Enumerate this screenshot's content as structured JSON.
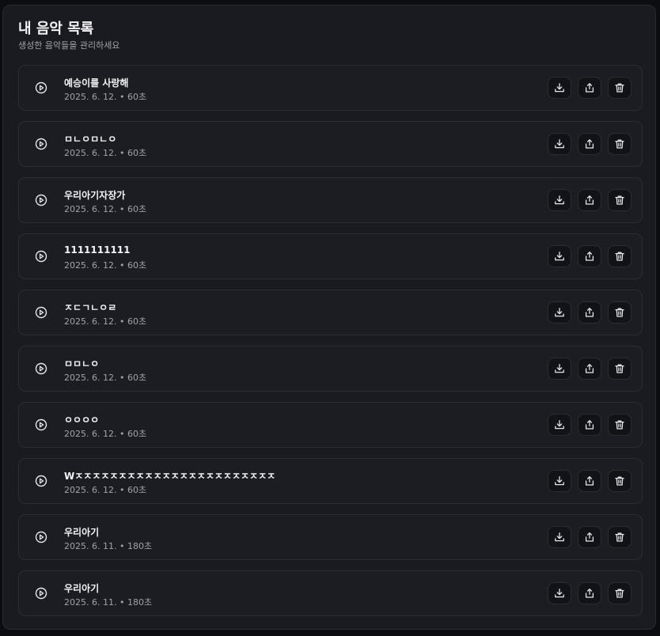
{
  "header": {
    "title": "내 음악 목록",
    "subtitle": "생성한 음악들을 관리하세요"
  },
  "icons": {
    "play": "play-circle-icon",
    "download": "download-icon",
    "share": "share-icon",
    "delete": "trash-icon"
  },
  "tracks": [
    {
      "title": "예승이를 사랑해",
      "meta": "2025. 6. 12. • 60초"
    },
    {
      "title": "ㅁㄴㅇㅁㄴㅇ",
      "meta": "2025. 6. 12. • 60초"
    },
    {
      "title": "우리아기자장가",
      "meta": "2025. 6. 12. • 60초"
    },
    {
      "title": "1111111111",
      "meta": "2025. 6. 12. • 60초"
    },
    {
      "title": "ㅈㄷㄱㄴㅇㄹ",
      "meta": "2025. 6. 12. • 60초"
    },
    {
      "title": "ㅁㅁㄴㅇ",
      "meta": "2025. 6. 12. • 60초"
    },
    {
      "title": "ㅇㅇㅇㅇ",
      "meta": "2025. 6. 12. • 60초"
    },
    {
      "title": "Wㅈㅈㅈㅈㅈㅈㅈㅈㅈㅈㅈㅈㅈㅈㅈㅈㅈㅈㅈㅈㅈㅈㅈ",
      "meta": "2025. 6. 12. • 60초"
    },
    {
      "title": "우리아기",
      "meta": "2025. 6. 11. • 180초"
    },
    {
      "title": "우리아기",
      "meta": "2025. 6. 11. • 180초"
    }
  ]
}
